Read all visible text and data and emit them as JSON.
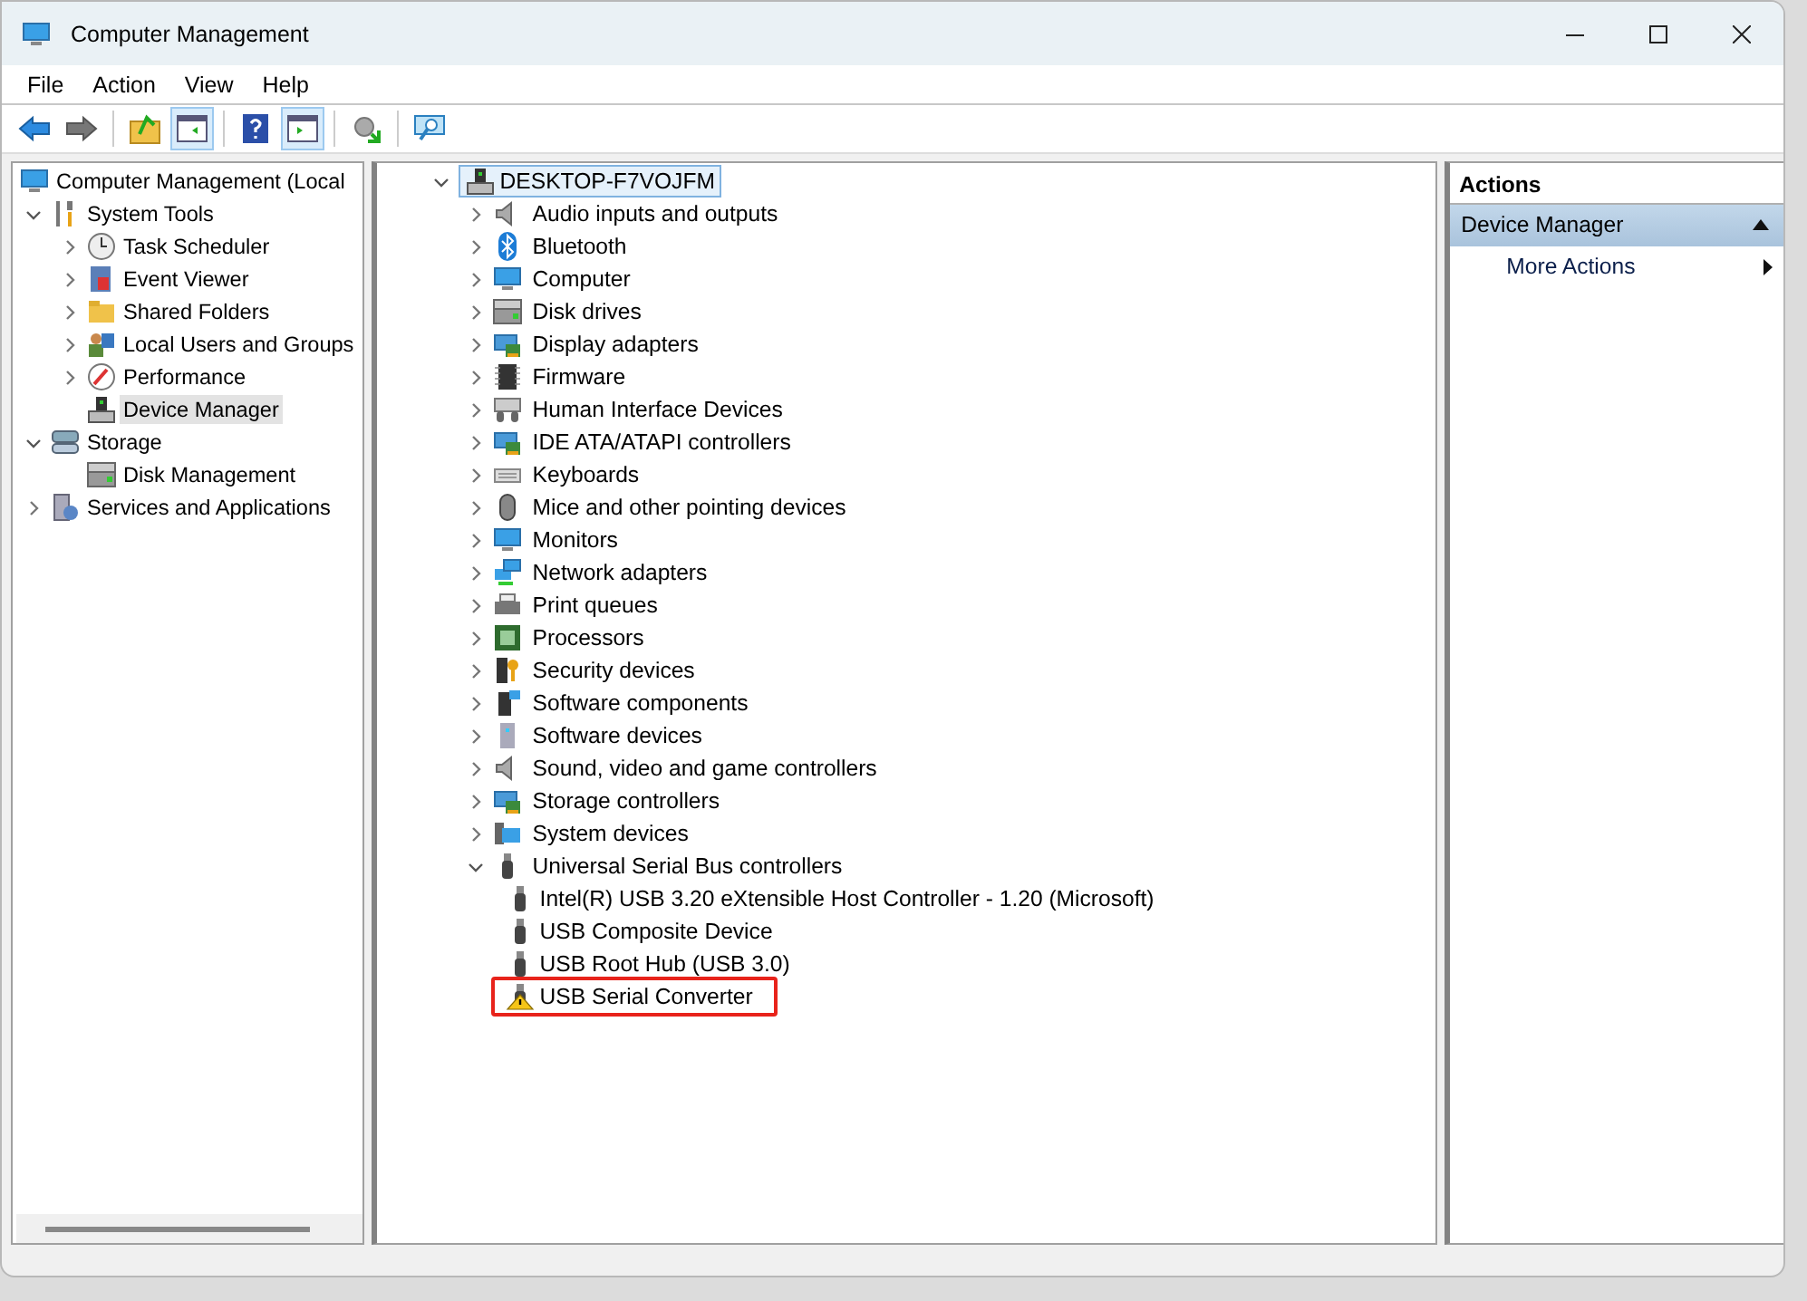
{
  "window": {
    "title": "Computer Management"
  },
  "menu": [
    "File",
    "Action",
    "View",
    "Help"
  ],
  "toolbar": [
    {
      "pressed": false
    },
    {
      "pressed": false
    },
    {
      "pressed": false
    },
    {
      "pressed": true
    },
    {
      "pressed": false
    },
    {
      "pressed": true
    },
    {
      "pressed": false
    },
    {
      "pressed": false
    }
  ],
  "console_tree": {
    "label": "Computer Management (Local",
    "selected": false,
    "children": [
      {
        "label": "System Tools",
        "kind": "branch",
        "expanded": true,
        "selected": false,
        "children": [
          {
            "label": "Task Scheduler",
            "kind": "branch",
            "expanded": false,
            "selected": false
          },
          {
            "label": "Event Viewer",
            "kind": "branch",
            "expanded": false,
            "selected": false
          },
          {
            "label": "Shared Folders",
            "kind": "branch",
            "expanded": false,
            "selected": false
          },
          {
            "label": "Local Users and Groups",
            "kind": "branch",
            "expanded": false,
            "selected": false
          },
          {
            "label": "Performance",
            "kind": "branch",
            "expanded": false,
            "selected": false
          },
          {
            "label": "Device Manager",
            "kind": "leaf",
            "selected": true
          }
        ]
      },
      {
        "label": "Storage",
        "kind": "branch",
        "expanded": true,
        "selected": false,
        "children": [
          {
            "label": "Disk Management",
            "kind": "leaf",
            "selected": false
          }
        ]
      },
      {
        "label": "Services and Applications",
        "kind": "branch",
        "expanded": false,
        "selected": false
      }
    ]
  },
  "device_tree": {
    "label": "DESKTOP-F7VOJFM",
    "selected": true,
    "expanded": true,
    "children": [
      {
        "label": "Audio inputs and outputs",
        "expanded": false
      },
      {
        "label": "Bluetooth",
        "expanded": false
      },
      {
        "label": "Computer",
        "expanded": false
      },
      {
        "label": "Disk drives",
        "expanded": false
      },
      {
        "label": "Display adapters",
        "expanded": false
      },
      {
        "label": "Firmware",
        "expanded": false
      },
      {
        "label": "Human Interface Devices",
        "expanded": false
      },
      {
        "label": "IDE ATA/ATAPI controllers",
        "expanded": false
      },
      {
        "label": "Keyboards",
        "expanded": false
      },
      {
        "label": "Mice and other pointing devices",
        "expanded": false
      },
      {
        "label": "Monitors",
        "expanded": false
      },
      {
        "label": "Network adapters",
        "expanded": false
      },
      {
        "label": "Print queues",
        "expanded": false
      },
      {
        "label": "Processors",
        "expanded": false
      },
      {
        "label": "Security devices",
        "expanded": false
      },
      {
        "label": "Software components",
        "expanded": false
      },
      {
        "label": "Software devices",
        "expanded": false
      },
      {
        "label": "Sound, video and game controllers",
        "expanded": false
      },
      {
        "label": "Storage controllers",
        "expanded": false
      },
      {
        "label": "System devices",
        "expanded": false
      },
      {
        "label": "Universal Serial Bus controllers",
        "expanded": true,
        "children": [
          {
            "label": "Intel(R) USB 3.20 eXtensible Host Controller - 1.20 (Microsoft)",
            "warning": false,
            "highlighted": false
          },
          {
            "label": "USB Composite Device",
            "warning": false,
            "highlighted": false
          },
          {
            "label": "USB Root Hub (USB 3.0)",
            "warning": false,
            "highlighted": false
          },
          {
            "label": "USB Serial Converter",
            "warning": true,
            "highlighted": true
          }
        ]
      }
    ]
  },
  "actions": {
    "title": "Actions",
    "section": {
      "label": "Device Manager",
      "expanded": true
    },
    "items": [
      "More Actions"
    ]
  }
}
